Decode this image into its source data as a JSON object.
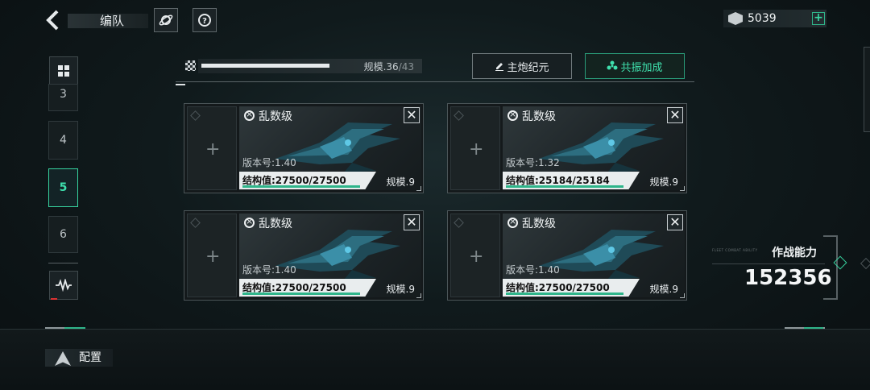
{
  "header": {
    "back_icon": "chevron-left-icon",
    "title": "编队",
    "planet_icon": "planet-icon",
    "help_icon": "question-icon",
    "currency_icon": "crystal-icon",
    "currency_value": "5039",
    "plus_label": "+"
  },
  "sidebar": {
    "grid_icon": "grid-icon",
    "slots": [
      "3",
      "4",
      "5",
      "6"
    ],
    "active_slot": "5",
    "wave_icon": "waveform-icon"
  },
  "capacity": {
    "label": "规模.",
    "current": "36",
    "max": "/43",
    "fill": 0.837
  },
  "actions": {
    "main_gun": "主炮纪元",
    "resonance": "共振加成"
  },
  "cards": [
    {
      "name": "乱数级",
      "version": "版本号:1.40",
      "hp": "结构值:27500/27500",
      "scale": "规模.9",
      "hp_ratio": 1.0
    },
    {
      "name": "乱数级",
      "version": "版本号:1.32",
      "hp": "结构值:25184/25184",
      "scale": "规模.9",
      "hp_ratio": 1.0
    },
    {
      "name": "乱数级",
      "version": "版本号:1.40",
      "hp": "结构值:27500/27500",
      "scale": "规模.9",
      "hp_ratio": 1.0
    },
    {
      "name": "乱数级",
      "version": "版本号:1.40",
      "hp": "结构值:27500/27500",
      "scale": "规模.9",
      "hp_ratio": 1.0
    }
  ],
  "power": {
    "label": "作战能力",
    "sub": "FLEET COMBAT ABILITY",
    "value": "152356"
  },
  "footer": {
    "config_label": "配置"
  },
  "colors": {
    "accent": "#37d4a0",
    "background": "#0b1114"
  }
}
